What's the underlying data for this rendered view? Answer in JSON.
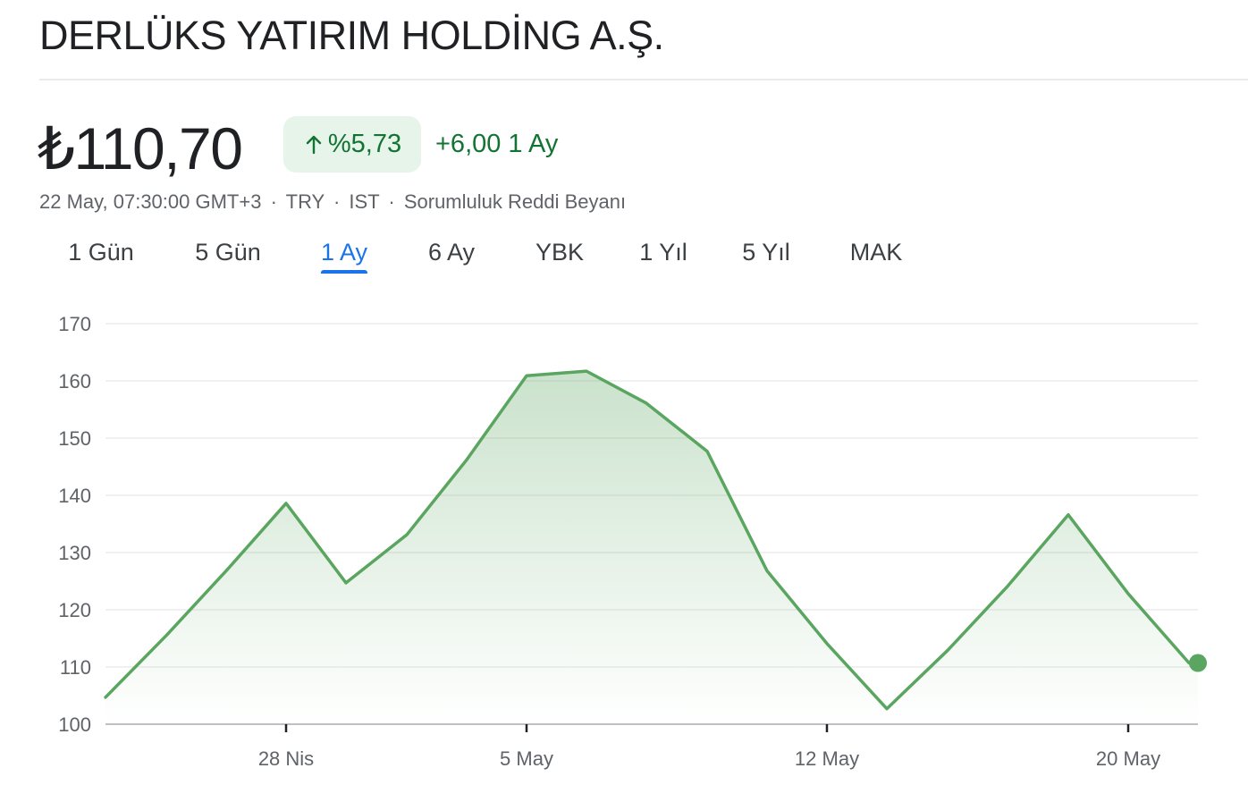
{
  "header": {
    "company_name": "DERLÜKS YATIRIM HOLDİNG A.Ş."
  },
  "quote": {
    "price": "₺110,70",
    "change_percent": "%5,73",
    "change_direction_icon": "arrow-up-icon",
    "change_absolute": "+6,00 1 Ay",
    "timestamp": "22 May, 07:30:00 GMT+3",
    "currency": "TRY",
    "exchange": "IST",
    "disclaimer": "Sorumluluk Reddi Beyanı",
    "separator": "·"
  },
  "range_tabs": [
    {
      "label": "1 Gün",
      "active": false
    },
    {
      "label": "5 Gün",
      "active": false
    },
    {
      "label": "1 Ay",
      "active": true
    },
    {
      "label": "6 Ay",
      "active": false
    },
    {
      "label": "YBK",
      "active": false
    },
    {
      "label": "1 Yıl",
      "active": false
    },
    {
      "label": "5 Yıl",
      "active": false
    },
    {
      "label": "MAK",
      "active": false
    }
  ],
  "colors": {
    "line": "#5aa55f",
    "positive_text": "#137333",
    "positive_badge_bg": "#e6f4ea",
    "active_tab": "#1a73e8"
  },
  "chart_data": {
    "type": "area",
    "x": [
      "2025-04-22",
      "2025-04-24",
      "2025-04-25",
      "2025-04-28",
      "2025-04-29",
      "2025-04-30",
      "2025-05-02",
      "2025-05-05",
      "2025-05-06",
      "2025-05-07",
      "2025-05-08",
      "2025-05-09",
      "2025-05-12",
      "2025-05-13",
      "2025-05-14",
      "2025-05-15",
      "2025-05-16",
      "2025-05-19",
      "2025-05-20",
      "2025-05-22"
    ],
    "values": [
      104.7,
      115.5,
      126.8,
      138.6,
      124.7,
      133.1,
      146.2,
      160.9,
      161.7,
      156.1,
      147.7,
      126.8,
      114.1,
      102.7,
      112.9,
      124.1,
      136.6,
      122.8,
      110.7,
      110.7
    ],
    "ylim": [
      100,
      170
    ],
    "yticks": [
      100,
      110,
      120,
      130,
      140,
      150,
      160,
      170
    ],
    "xtick_labels": [
      {
        "label": "28 Nis",
        "index": 3
      },
      {
        "label": "5 May",
        "index": 7
      },
      {
        "label": "12 May",
        "index": 12
      },
      {
        "label": "20 May",
        "index": 17
      }
    ],
    "title": "",
    "xlabel": "",
    "ylabel": "",
    "grid": true,
    "end_marker": true
  }
}
